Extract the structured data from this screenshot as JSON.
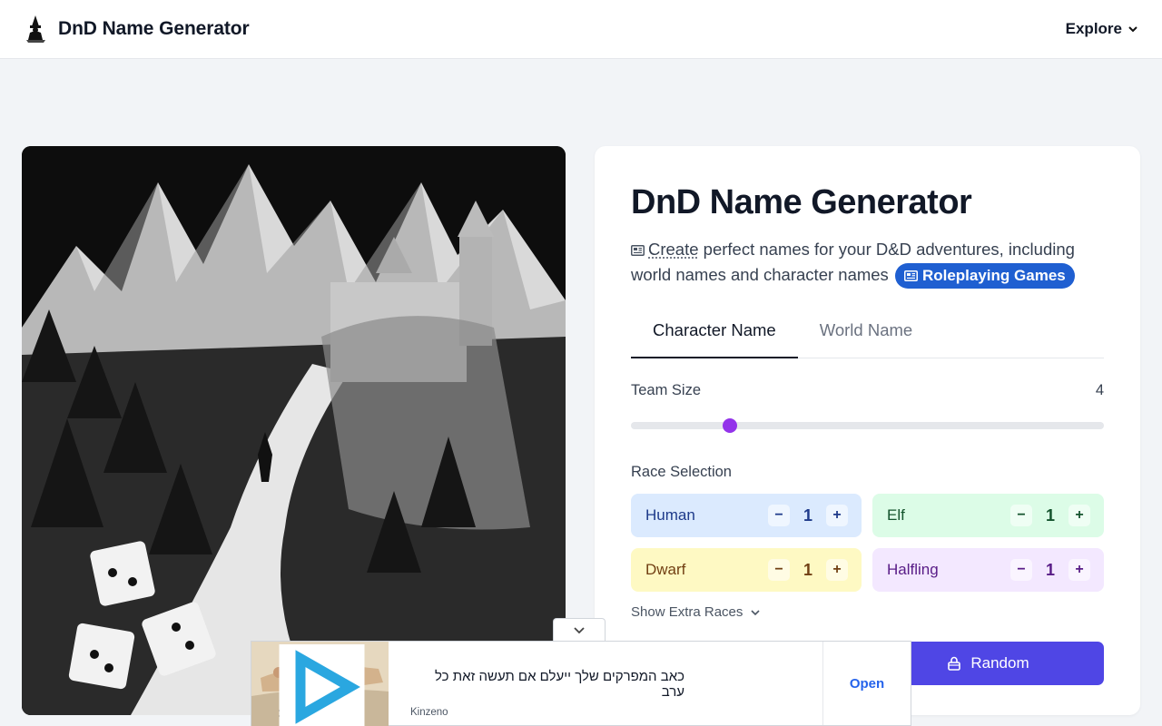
{
  "header": {
    "brand_title": "DnD Name Generator",
    "explore_label": "Explore"
  },
  "card": {
    "title": "DnD Name Generator",
    "description_create": "Create",
    "description_rest": " perfect names for your D&D adventures, including world names and character names",
    "tag_label": "Roleplaying Games",
    "tabs": [
      {
        "label": "Character Name",
        "active": true
      },
      {
        "label": "World Name",
        "active": false
      }
    ],
    "team_size": {
      "label": "Team Size",
      "value": "4",
      "level": 0.21
    },
    "race_selection_label": "Race Selection",
    "races": [
      {
        "name": "Human",
        "count": "1",
        "minus": "−",
        "plus": "+"
      },
      {
        "name": "Elf",
        "count": "1",
        "minus": "−",
        "plus": "+"
      },
      {
        "name": "Dwarf",
        "count": "1",
        "minus": "−",
        "plus": "+"
      },
      {
        "name": "Halfling",
        "count": "1",
        "minus": "−",
        "plus": "+"
      }
    ],
    "show_extra_label": "Show Extra Races",
    "random_label": "Random"
  },
  "ad": {
    "headline": "כאב המפרקים שלך ייעלם אם תעשה זאת כל ערב",
    "source": "Kinzeno",
    "open_label": "Open"
  },
  "colors": {
    "accent": "#4f46e5",
    "slider_thumb": "#9333ea",
    "tag_bg": "#1f5fd1"
  }
}
